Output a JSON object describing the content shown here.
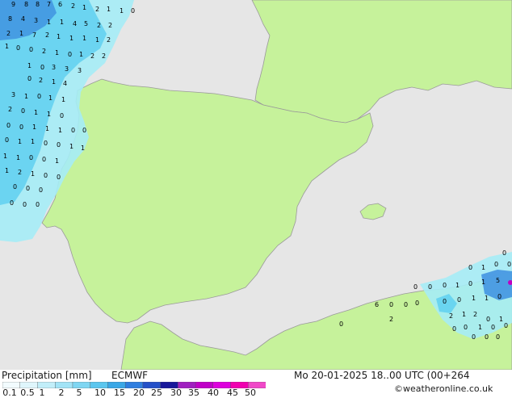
{
  "map": {
    "colors": {
      "sea": "#e6e6e6",
      "land": "#c6f29b",
      "border": "#9a9a9a",
      "precip_light": "#a5ecf6",
      "precip_mid": "#5fd0f0",
      "precip_heavy": "#3d8fe0",
      "precip_max": "#2a4fd6",
      "precip_peak": "#c000c0"
    },
    "point_values_nw": [
      "9",
      "8",
      "8",
      "7",
      "6",
      "2",
      "1",
      "2",
      "1",
      "1",
      "0",
      "8",
      "4",
      "3",
      "1",
      "1",
      "4",
      "5",
      "2",
      "2",
      "2",
      "1",
      "7",
      "2",
      "1",
      "1",
      "1",
      "1",
      "2",
      "1",
      "0",
      "0",
      "2",
      "1",
      "0",
      "1",
      "2",
      "2",
      "1",
      "0",
      "3",
      "3",
      "3",
      "0",
      "2",
      "1",
      "4",
      "3",
      "1",
      "0",
      "1",
      "1",
      "2",
      "0",
      "1",
      "1",
      "0",
      "0",
      "0",
      "1",
      "1",
      "1",
      "0",
      "0",
      "0",
      "1",
      "1",
      "0",
      "0",
      "1",
      "1",
      "1",
      "1",
      "0",
      "0",
      "1",
      "1",
      "2",
      "1",
      "0",
      "0",
      "0",
      "0",
      "0",
      "0",
      "0",
      "0",
      "0"
    ],
    "point_values_se": [
      "0",
      "1",
      "0",
      "0",
      "0",
      "0",
      "1",
      "0",
      "1",
      "5",
      "6",
      "0",
      "0",
      "0",
      "0",
      "0",
      "1",
      "1",
      "0",
      "2",
      "1",
      "2",
      "2",
      "0",
      "1",
      "0",
      "0",
      "1",
      "0",
      "0",
      "0",
      "0",
      "0",
      "0",
      "0",
      "0"
    ]
  },
  "footer": {
    "title": "Precipitation [mm]",
    "model": "ECMWF",
    "datetime": "Mo 20-01-2025 18..00 UTC (00+264",
    "credit": "©weatheronline.co.uk",
    "scale_labels": [
      "0.1",
      "0.5",
      "1",
      "2",
      "5",
      "10",
      "15",
      "20",
      "25",
      "30",
      "35",
      "40",
      "45",
      "50"
    ],
    "scale_colors": [
      "#f2fbfe",
      "#dff6fc",
      "#c2eef9",
      "#a2e3f6",
      "#7fd6f2",
      "#5bc6ee",
      "#3aa7e6",
      "#2f7edf",
      "#2450c8",
      "#18189a",
      "#a020c0",
      "#c000c8",
      "#dd00dd",
      "#f000b0",
      "#f048c8"
    ]
  }
}
